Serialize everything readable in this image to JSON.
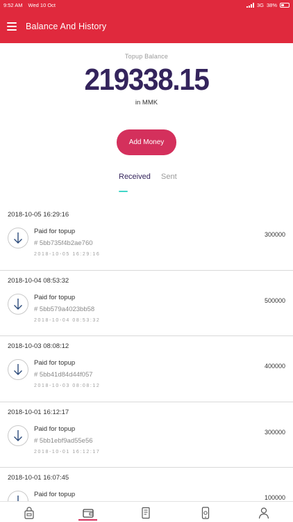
{
  "status_bar": {
    "time": "9:52 AM",
    "date": "Wed 10 Oct",
    "network": "3G",
    "battery": "38%"
  },
  "header": {
    "title": "Balance And History",
    "menu_icon": "hamburger-menu-icon"
  },
  "balance": {
    "label": "Topup Balance",
    "amount": "219338.15",
    "currency": "in MMK"
  },
  "actions": {
    "add_money": "Add Money"
  },
  "tabs": [
    {
      "label": "Received",
      "active": true
    },
    {
      "label": "Sent",
      "active": false
    }
  ],
  "groups": [
    {
      "date": "2018-10-05 16:29:16",
      "title": "Paid for topup",
      "ref": "# 5bb735f4b2ae760",
      "time": "2018-10-05 16:29:16",
      "amount": "300000"
    },
    {
      "date": "2018-10-04 08:53:32",
      "title": "Paid for topup",
      "ref": "# 5bb579a4023bb58",
      "time": "2018-10-04 08:53:32",
      "amount": "500000"
    },
    {
      "date": "2018-10-03 08:08:12",
      "title": "Paid for topup",
      "ref": "# 5bb41d84d44f057",
      "time": "2018-10-03 08:08:12",
      "amount": "400000"
    },
    {
      "date": "2018-10-01 16:12:17",
      "title": "Paid for topup",
      "ref": "# 5bb1ebf9ad55e56",
      "time": "2018-10-01 16:12:17",
      "amount": "300000"
    },
    {
      "date": "2018-10-01 16:07:45",
      "title": "Paid for topup",
      "ref": "",
      "time": "",
      "amount": "100000"
    }
  ],
  "bottom_nav": [
    {
      "icon": "shopping-bag-icon",
      "active": false
    },
    {
      "icon": "wallet-icon",
      "active": true
    },
    {
      "icon": "document-icon",
      "active": false
    },
    {
      "icon": "phone-topup-icon",
      "active": false
    },
    {
      "icon": "profile-icon",
      "active": false
    }
  ],
  "colors": {
    "header": "#e0293d",
    "accent": "#d4305c",
    "balance_text": "#34245c",
    "tab_indicator": "#42d6c8"
  }
}
